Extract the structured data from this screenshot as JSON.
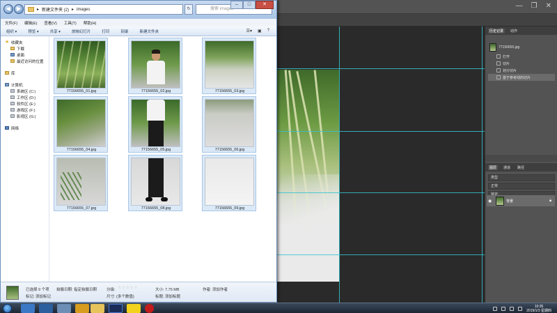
{
  "explorer": {
    "address_path": [
      "新建文件夹 (2)",
      "images"
    ],
    "search_placeholder": "搜索 images",
    "menu": [
      "文件(F)",
      "编辑(E)",
      "查看(V)",
      "工具(T)",
      "帮助(H)"
    ],
    "toolbar": [
      "组织 ▾",
      "预览 ▾",
      "共享 ▾",
      "放映幻灯片",
      "打印",
      "刻录",
      "新建文件夹"
    ],
    "sidebar": {
      "favorites_head": "收藏夹",
      "favorites": [
        "下载",
        "桌面",
        "最近访问的位置"
      ],
      "libraries_head": "库",
      "computer_head": "计算机",
      "drives": [
        "系统区 (C:)",
        "工作区 (D:)",
        "软件区 (E:)",
        "游戏区 (F:)",
        "影视区 (G:)"
      ],
      "network_head": "网络"
    },
    "files": [
      {
        "name": "77156655_01.jpg",
        "thumb": "bamboo"
      },
      {
        "name": "77156655_02.jpg",
        "thumb": "man"
      },
      {
        "name": "77156655_03.jpg",
        "thumb": "path"
      },
      {
        "name": "77156655_04.jpg",
        "thumb": "grass"
      },
      {
        "name": "77156655_05.jpg",
        "thumb": "man"
      },
      {
        "name": "77156655_06.jpg",
        "thumb": "gravel"
      },
      {
        "name": "77156655_07.jpg",
        "thumb": "plant"
      },
      {
        "name": "77156655_08.jpg",
        "thumb": "legs"
      },
      {
        "name": "77156655_09.jpg",
        "thumb": "blank"
      }
    ],
    "details": {
      "selected": "已选择 9 个项",
      "taken_label": "拍摄日期: 指定拍摄日期",
      "tags_label": "标记: 添加标记",
      "rating_label": "分级:",
      "dims_label": "尺寸: (多个数值)",
      "size_label": "大小: 7.75 MB",
      "title_label": "标题: 添加标题",
      "authors_label": "作者: 添加作者"
    }
  },
  "photoshop": {
    "panel_tabs_top": [
      "历史记录",
      "动作"
    ],
    "history": [
      "77156655.jpg",
      "打开",
      "切片",
      "划分切片",
      "基于参考线的切片"
    ],
    "panel_tabs_bottom": [
      "图层",
      "通道",
      "路径"
    ],
    "kind_label": "类型",
    "normal_label": "正常",
    "lock_label": "锁定:",
    "layer_name": "背景"
  },
  "taskbar": {
    "time": "10:35",
    "date": "2019/1/3 星期四"
  },
  "colors": {
    "guide": "#36c3d0",
    "ps_panel": "#535353",
    "explorer_tile": "#dbe9f7"
  }
}
